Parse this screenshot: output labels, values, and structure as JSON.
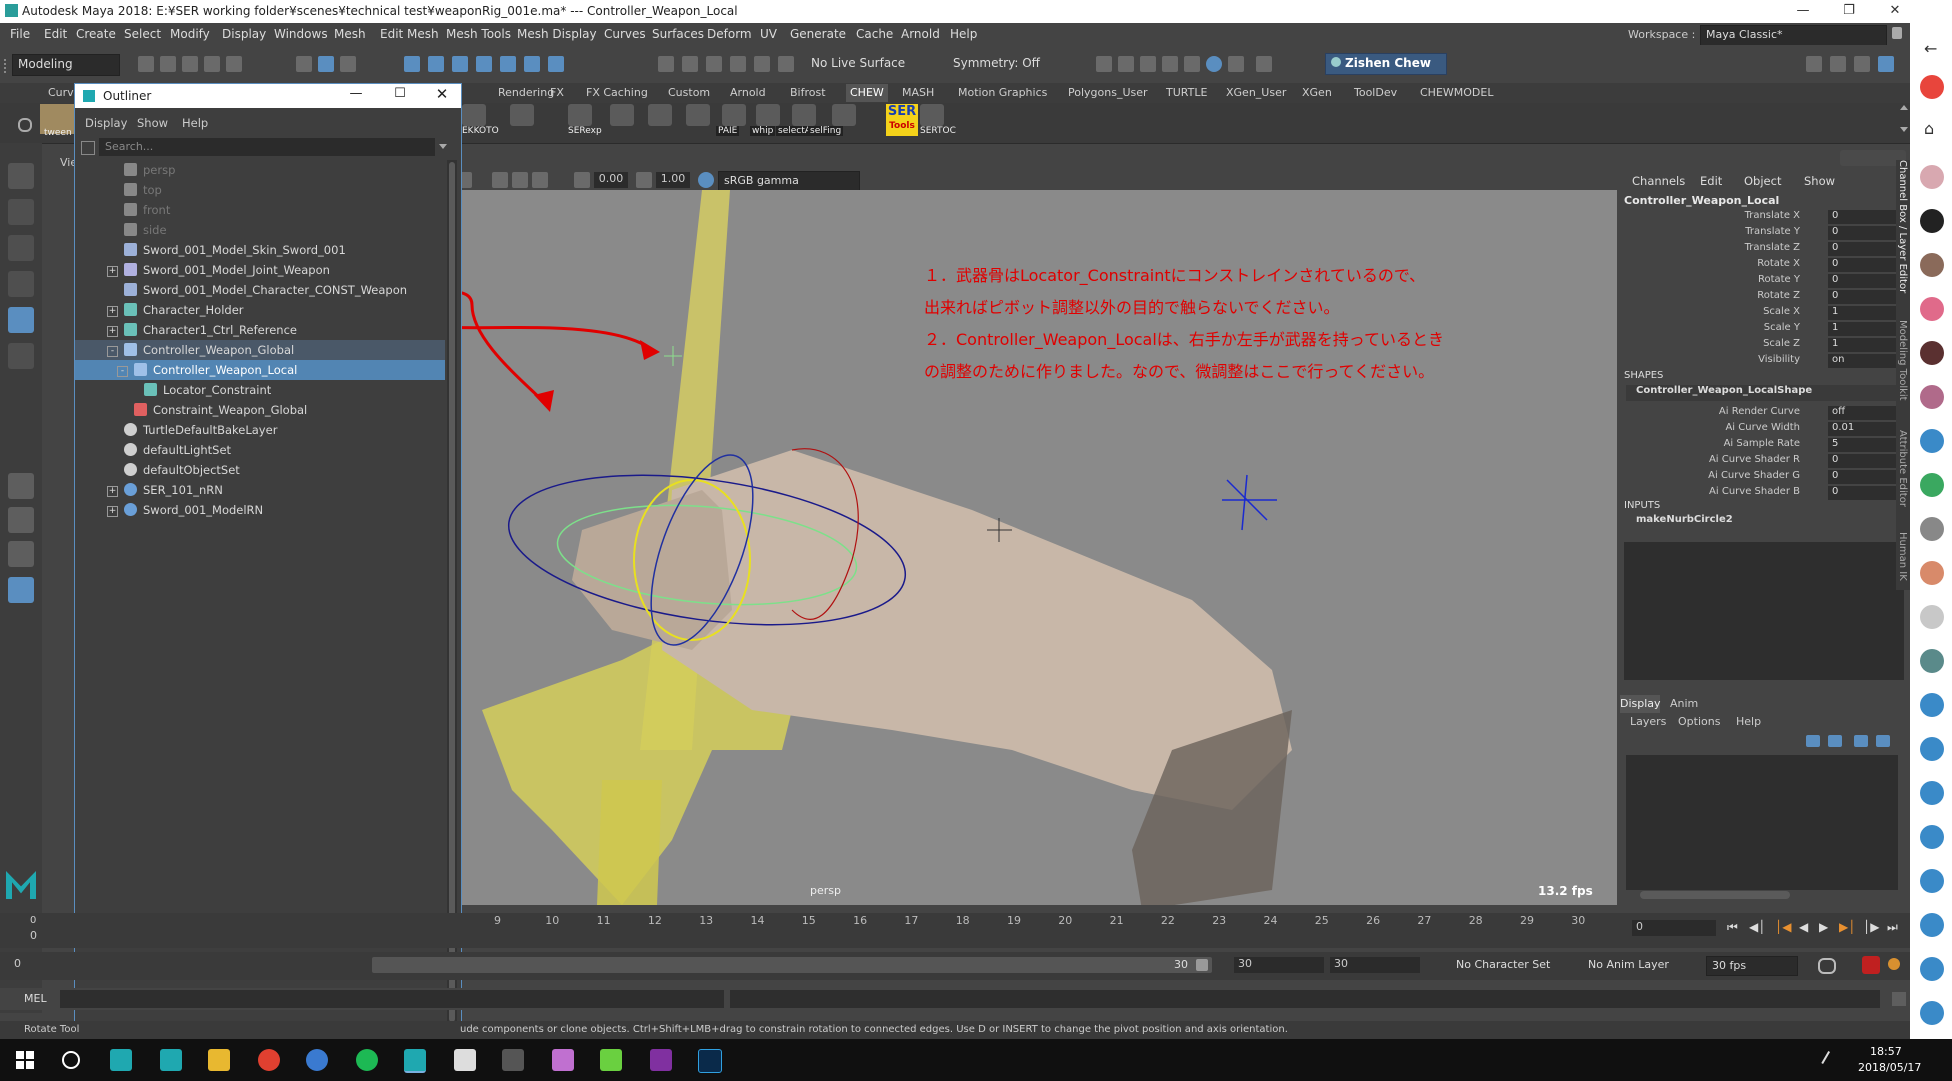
{
  "window": {
    "title": "Autodesk Maya 2018: E:¥SER working folder¥scenes¥technical test¥weaponRig_001e.ma*   ---   Controller_Weapon_Local"
  },
  "menubar": [
    "File",
    "Edit",
    "Create",
    "Select",
    "Modify",
    "Display",
    "Windows",
    "Mesh",
    "Edit Mesh",
    "Mesh Tools",
    "Mesh Display",
    "Curves",
    "Surfaces",
    "Deform",
    "UV",
    "Generate",
    "Cache",
    "Arnold",
    "Help"
  ],
  "workspace": {
    "label": "Workspace :",
    "value": "Maya Classic*"
  },
  "statusline": {
    "mode": "Modeling",
    "live_surface": "No Live Surface",
    "symmetry": "Symmetry: Off",
    "user": "Zishen Chew"
  },
  "shelf": {
    "tabs": [
      "Curv",
      "Rendering",
      "FX",
      "FX Caching",
      "Custom",
      "Arnold",
      "Bifrost",
      "CHEW",
      "MASH",
      "Motion Graphics",
      "Polygons_User",
      "TURTLE",
      "XGen_User",
      "XGen",
      "ToolDev",
      "CHEWMODEL"
    ],
    "active_tab": "CHEW",
    "icon_labels": [
      "EKKOTO",
      "SERexp",
      "PAIE",
      "whip",
      "selectA",
      "selFing",
      "SERTOC"
    ],
    "ser_icon": {
      "top": "SER",
      "bottom": "Tools"
    },
    "tween_label": "tween"
  },
  "outliner": {
    "title": "Outliner",
    "menus": [
      "Display",
      "Show",
      "Help"
    ],
    "search_placeholder": "Search...",
    "items": [
      {
        "label": "persp",
        "indent": 1,
        "dim": true,
        "expand": "",
        "icon": "camera"
      },
      {
        "label": "top",
        "indent": 1,
        "dim": true,
        "expand": "",
        "icon": "camera"
      },
      {
        "label": "front",
        "indent": 1,
        "dim": true,
        "expand": "",
        "icon": "camera"
      },
      {
        "label": "side",
        "indent": 1,
        "dim": true,
        "expand": "",
        "icon": "camera"
      },
      {
        "label": "Sword_001_Model_Skin_Sword_001",
        "indent": 1,
        "dim": false,
        "expand": "",
        "icon": "mesh"
      },
      {
        "label": "Sword_001_Model_Joint_Weapon",
        "indent": 1,
        "dim": false,
        "expand": "+",
        "icon": "joint"
      },
      {
        "label": "Sword_001_Model_Character_CONST_Weapon",
        "indent": 1,
        "dim": false,
        "expand": "",
        "icon": "mesh"
      },
      {
        "label": "Character_Holder",
        "indent": 1,
        "dim": false,
        "expand": "+",
        "icon": "locator"
      },
      {
        "label": "Character1_Ctrl_Reference",
        "indent": 1,
        "dim": false,
        "expand": "+",
        "icon": "locator"
      },
      {
        "label": "Controller_Weapon_Global",
        "indent": 1,
        "dim": false,
        "expand": "-",
        "icon": "curve",
        "state": "hl"
      },
      {
        "label": "Controller_Weapon_Local",
        "indent": 2,
        "dim": false,
        "expand": "-",
        "icon": "curve",
        "state": "sel"
      },
      {
        "label": "Locator_Constraint",
        "indent": 3,
        "dim": false,
        "expand": "",
        "icon": "locator"
      },
      {
        "label": "Constraint_Weapon_Global",
        "indent": 2,
        "dim": false,
        "expand": "",
        "icon": "constraint"
      },
      {
        "label": "TurtleDefaultBakeLayer",
        "indent": 1,
        "dim": false,
        "expand": "",
        "icon": "set"
      },
      {
        "label": "defaultLightSet",
        "indent": 1,
        "dim": false,
        "expand": "",
        "icon": "set"
      },
      {
        "label": "defaultObjectSet",
        "indent": 1,
        "dim": false,
        "expand": "",
        "icon": "set"
      },
      {
        "label": "SER_101_nRN",
        "indent": 1,
        "dim": false,
        "expand": "+",
        "icon": "ref"
      },
      {
        "label": "Sword_001_ModelRN",
        "indent": 1,
        "dim": false,
        "expand": "+",
        "icon": "ref"
      }
    ]
  },
  "viewport": {
    "gamma": "sRGB gamma",
    "exposure": "0.00",
    "gamma_value": "1.00",
    "camera": "persp",
    "fps": "13.2 fps",
    "panel_menu": "Vie",
    "annotation": [
      "１．武器骨はLocator_Constraintにコンストレインされているので、",
      "出来ればピボット調整以外の目的で触らないでください。",
      "２．Controller_Weapon_Localは、右手か左手が武器を持っているとき",
      "の調整のために作りました。なので、微調整はここで行ってください。"
    ]
  },
  "channel_box": {
    "menus": [
      "Channels",
      "Edit",
      "Object",
      "Show"
    ],
    "object": "Controller_Weapon_Local",
    "channels": [
      {
        "name": "Translate X",
        "value": "0"
      },
      {
        "name": "Translate Y",
        "value": "0"
      },
      {
        "name": "Translate Z",
        "value": "0"
      },
      {
        "name": "Rotate X",
        "value": "0"
      },
      {
        "name": "Rotate Y",
        "value": "0"
      },
      {
        "name": "Rotate Z",
        "value": "0"
      },
      {
        "name": "Scale X",
        "value": "1"
      },
      {
        "name": "Scale Y",
        "value": "1"
      },
      {
        "name": "Scale Z",
        "value": "1"
      },
      {
        "name": "Visibility",
        "value": "on"
      }
    ],
    "shapes_header": "SHAPES",
    "shape_name": "Controller_Weapon_LocalShape",
    "shape_channels": [
      {
        "name": "Ai Render Curve",
        "value": "off"
      },
      {
        "name": "Ai Curve Width",
        "value": "0.01"
      },
      {
        "name": "Ai Sample Rate",
        "value": "5"
      },
      {
        "name": "Ai Curve Shader R",
        "value": "0"
      },
      {
        "name": "Ai Curve Shader G",
        "value": "0"
      },
      {
        "name": "Ai Curve Shader B",
        "value": "0"
      }
    ],
    "inputs_header": "INPUTS",
    "input_name": "makeNurbCircle2"
  },
  "side_tabs": [
    "Channel Box / Layer Editor",
    "Modeling Toolkit",
    "Attribute Editor",
    "Human IK"
  ],
  "layer_editor": {
    "tabs": [
      "Display",
      "Anim"
    ],
    "menus": [
      "Layers",
      "Options",
      "Help"
    ]
  },
  "timeline": {
    "ticks": [
      "9",
      "10",
      "11",
      "12",
      "13",
      "14",
      "15",
      "16",
      "17",
      "18",
      "19",
      "20",
      "21",
      "22",
      "23",
      "24",
      "25",
      "26",
      "27",
      "28",
      "29",
      "30"
    ],
    "current_frame": "0",
    "left_top": "0",
    "left_bottom": "0",
    "range_start": "0",
    "range_end_inner": "30",
    "range_end": "30",
    "range_end2": "30",
    "character_set": "No Character Set",
    "anim_layer": "No Anim Layer",
    "fps": "30 fps"
  },
  "command_line": {
    "label": "MEL"
  },
  "help_line": {
    "tool": "Rotate Tool",
    "text": "ude components or clone objects. Ctrl+Shift+LMB+drag to constrain rotation to connected edges. Use D or INSERT to change the pivot position and axis orientation."
  },
  "taskbar": {
    "time": "18:57",
    "date": "2018/05/17"
  }
}
